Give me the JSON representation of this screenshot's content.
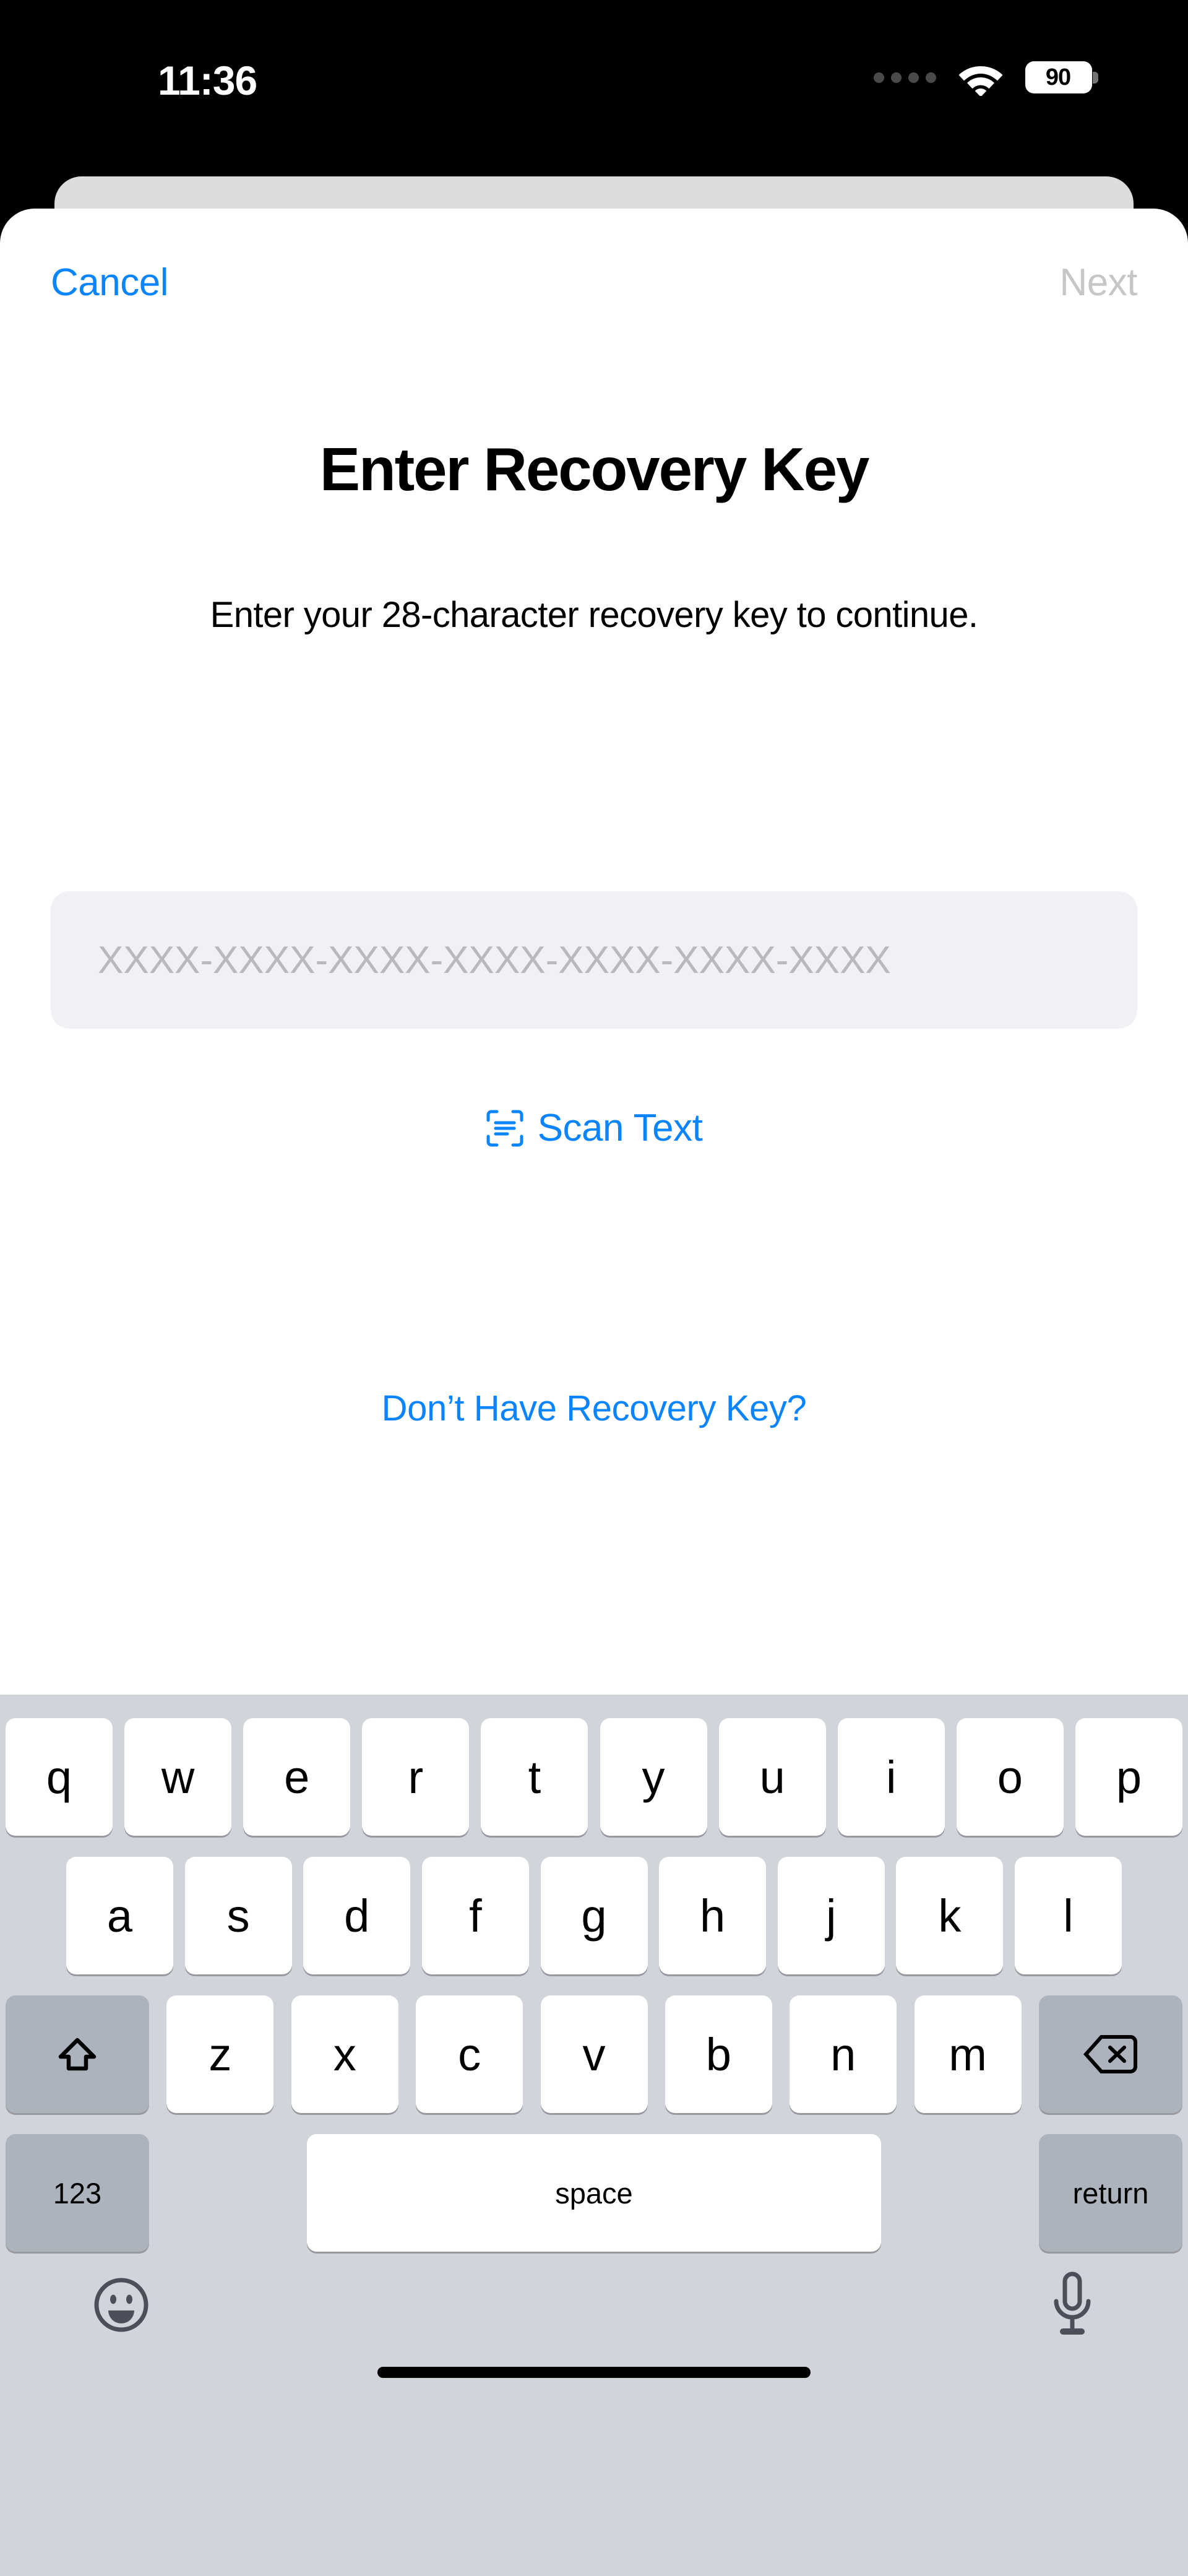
{
  "status_bar": {
    "time": "11:36",
    "battery_level": "90",
    "signal_icon": "cellular-dots-icon",
    "wifi_icon": "wifi-icon",
    "battery_icon": "battery-icon"
  },
  "nav": {
    "cancel_label": "Cancel",
    "next_label": "Next",
    "cancel_color": "#0a84ff",
    "next_color": "#c6c6c8"
  },
  "content": {
    "title": "Enter Recovery Key",
    "subtitle": "Enter your 28-character recovery key to continue.",
    "recovery_key_value": "",
    "recovery_key_placeholder": "XXXX-XXXX-XXXX-XXXX-XXXX-XXXX-XXXX",
    "scan_text_label": "Scan Text",
    "scan_text_icon": "scan-text-icon",
    "no_key_link_label": "Don’t Have Recovery Key?",
    "accent_color": "#0a84ff",
    "field_background": "#f1f1f5"
  },
  "keyboard": {
    "row1": [
      "q",
      "w",
      "e",
      "r",
      "t",
      "y",
      "u",
      "i",
      "o",
      "p"
    ],
    "row2": [
      "a",
      "s",
      "d",
      "f",
      "g",
      "h",
      "j",
      "k",
      "l"
    ],
    "row3": [
      "z",
      "x",
      "c",
      "v",
      "b",
      "n",
      "m"
    ],
    "shift_icon": "shift-arrow-icon",
    "backspace_icon": "backspace-delete-icon",
    "numbers_label": "123",
    "space_label": "space",
    "return_label": "return",
    "emoji_icon": "emoji-smiley-icon",
    "dictation_icon": "microphone-icon",
    "background_color": "#d1d4db",
    "key_color": "#ffffff",
    "modifier_key_color": "#adb3bd"
  }
}
